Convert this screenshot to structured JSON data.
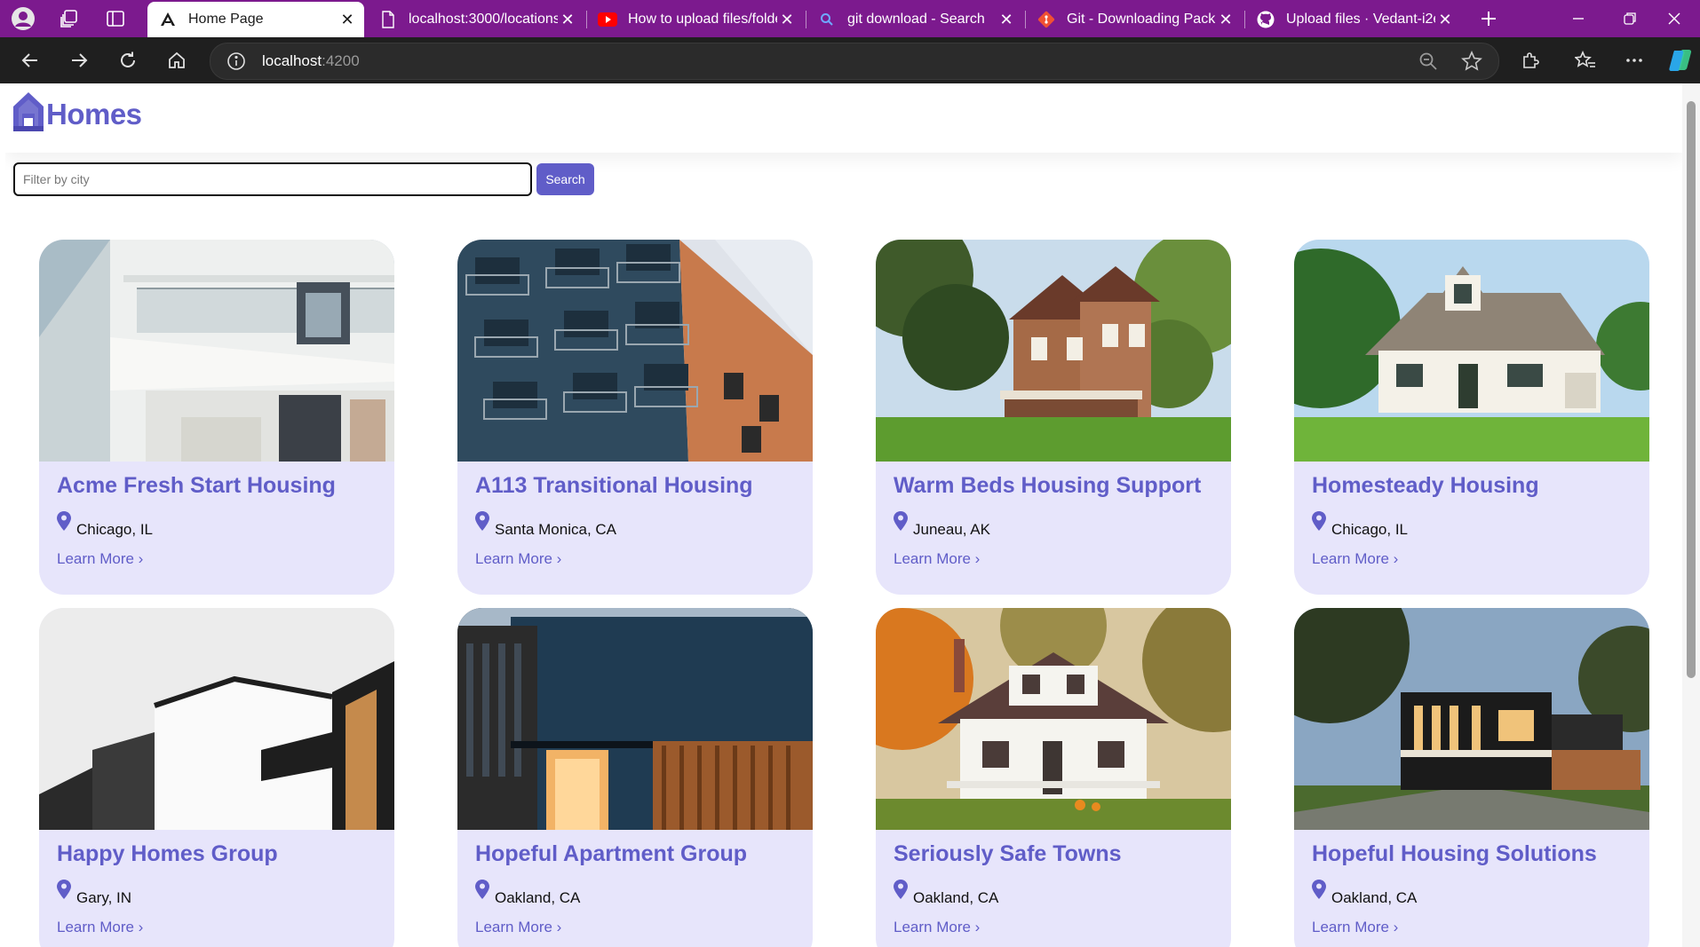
{
  "browser": {
    "tabs": [
      {
        "title": "Home Page",
        "icon": "angular-icon",
        "active": true
      },
      {
        "title": "localhost:3000/locations",
        "icon": "page-icon",
        "active": false
      },
      {
        "title": "How to upload files/folde",
        "icon": "youtube-icon",
        "active": false
      },
      {
        "title": "git download - Search",
        "icon": "search-icon",
        "active": false
      },
      {
        "title": "Git - Downloading Packag",
        "icon": "git-icon",
        "active": false
      },
      {
        "title": "Upload files · Vedant-i2e/",
        "icon": "github-icon",
        "active": false
      }
    ],
    "url_host": "localhost",
    "url_port": ":4200",
    "colors": {
      "tabbar": "#7c1a8e",
      "toolbar": "#1f1f1f"
    }
  },
  "header": {
    "brand": "Homes",
    "logo_icon": "house-icon",
    "accent": "#605dc8"
  },
  "search": {
    "placeholder": "Filter by city",
    "value": "",
    "button_label": "Search"
  },
  "cards": [
    {
      "name": "Acme Fresh Start Housing",
      "location": "Chicago, IL",
      "link": "Learn More ›",
      "photo": "modern-white-balconies"
    },
    {
      "name": "A113 Transitional Housing",
      "location": "Santa Monica, CA",
      "link": "Learn More ›",
      "photo": "blue-orange-apartment-block"
    },
    {
      "name": "Warm Beds Housing Support",
      "location": "Juneau, AK",
      "link": "Learn More ›",
      "photo": "victorian-house"
    },
    {
      "name": "Homesteady Housing",
      "location": "Chicago, IL",
      "link": "Learn More ›",
      "photo": "white-cottage"
    },
    {
      "name": "Happy Homes Group",
      "location": "Gary, IN",
      "link": "Learn More ›",
      "photo": "minimal-white-black-house"
    },
    {
      "name": "Hopeful Apartment Group",
      "location": "Oakland, CA",
      "link": "Learn More ›",
      "photo": "dark-modern-building"
    },
    {
      "name": "Seriously Safe Towns",
      "location": "Oakland, CA",
      "link": "Learn More ›",
      "photo": "craftsman-house-autumn"
    },
    {
      "name": "Hopeful Housing Solutions",
      "location": "Oakland, CA",
      "link": "Learn More ›",
      "photo": "modern-house-dusk"
    }
  ]
}
